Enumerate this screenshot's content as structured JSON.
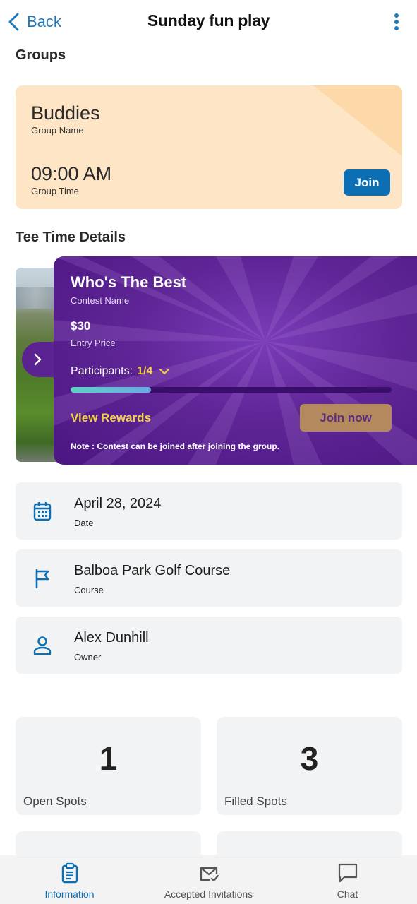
{
  "header": {
    "back_label": "Back",
    "title": "Sunday fun play"
  },
  "groups": {
    "section_title": "Groups",
    "name": "Buddies",
    "name_label": "Group Name",
    "time": "09:00 AM",
    "time_label": "Group Time",
    "join_label": "Join",
    "card_color": "#fde5c5"
  },
  "tee_time": {
    "section_title": "Tee Time Details",
    "contest": {
      "name": "Who's The Best",
      "name_label": "Contest Name",
      "price": "$30",
      "price_label": "Entry Price",
      "participants_label": "Participants:",
      "participants_count": "1/4",
      "progress_fraction": 0.25,
      "view_rewards_label": "View Rewards",
      "join_now_label": "Join now",
      "note": "Note : Contest can be joined after joining the group."
    }
  },
  "details": [
    {
      "value": "April 28, 2024",
      "label": "Date",
      "icon": "calendar-icon"
    },
    {
      "value": "Balboa Park Golf Course",
      "label": "Course",
      "icon": "flag-icon"
    },
    {
      "value": "Alex Dunhill",
      "label": "Owner",
      "icon": "person-icon"
    }
  ],
  "stats": [
    {
      "value": "1",
      "label": "Open Spots"
    },
    {
      "value": "3",
      "label": "Filled Spots"
    }
  ],
  "bottom_nav": [
    {
      "label": "Information",
      "icon": "clipboard-icon",
      "active": true
    },
    {
      "label": "Accepted Invitations",
      "icon": "mail-check-icon",
      "active": false
    },
    {
      "label": "Chat",
      "icon": "chat-icon",
      "active": false
    }
  ],
  "colors": {
    "accent": "#0d6fb3",
    "contest_purple": "#5f2596",
    "highlight_yellow": "#f2d43e"
  }
}
